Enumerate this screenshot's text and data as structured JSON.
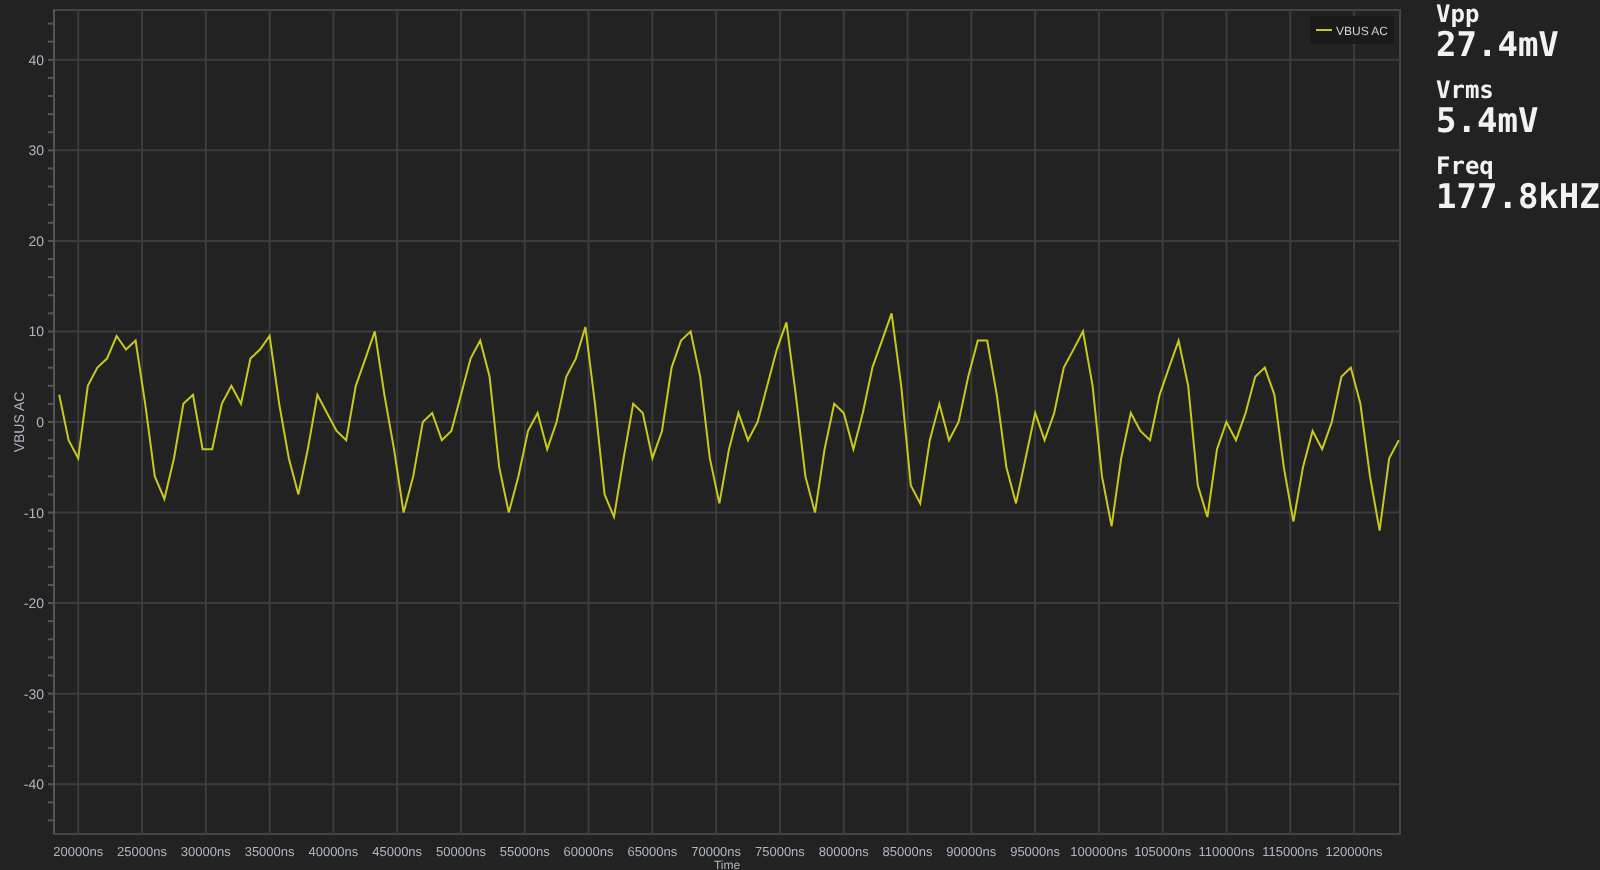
{
  "chart": {
    "chart_data": {
      "type": "line",
      "xlabel": "Time",
      "ylabel": "VBUS AC",
      "x": [
        18500,
        19250,
        20000,
        20750,
        21500,
        22250,
        23000,
        23750,
        24500,
        25250,
        26000,
        26750,
        27500,
        28250,
        29000,
        29750,
        30500,
        31250,
        32000,
        32750,
        33500,
        34250,
        35000,
        35750,
        36500,
        37250,
        38000,
        38750,
        39500,
        40250,
        41000,
        41750,
        42500,
        43250,
        44000,
        44750,
        45500,
        46250,
        47000,
        47750,
        48500,
        49250,
        50000,
        50750,
        51500,
        52250,
        53000,
        53750,
        54500,
        55250,
        56000,
        56750,
        57500,
        58250,
        59000,
        59750,
        60500,
        61250,
        62000,
        62750,
        63500,
        64250,
        65000,
        65750,
        66500,
        67250,
        68000,
        68750,
        69500,
        70250,
        71000,
        71750,
        72500,
        73250,
        74000,
        74750,
        75500,
        76250,
        77000,
        77750,
        78500,
        79250,
        80000,
        80750,
        81500,
        82250,
        83000,
        83750,
        84500,
        85250,
        86000,
        86750,
        87500,
        88250,
        89000,
        89750,
        90500,
        91250,
        92000,
        92750,
        93500,
        94250,
        95000,
        95750,
        96500,
        97250,
        98000,
        98750,
        99500,
        100250,
        101000,
        101750,
        102500,
        103250,
        104000,
        104750,
        105500,
        106250,
        107000,
        107750,
        108500,
        109250,
        110000,
        110750,
        111500,
        112250,
        113000,
        113750,
        114500,
        115250,
        116000,
        116750,
        117500,
        118250,
        119000,
        119750,
        120500,
        121250,
        122000,
        122750,
        123500
      ],
      "series": [
        {
          "name": "VBUS AC",
          "color": "#c8c81e",
          "values": [
            3,
            -2,
            -4,
            4,
            6,
            7,
            9.5,
            8,
            9,
            2,
            -6,
            -8.5,
            -4,
            2,
            3,
            -3,
            -3,
            2,
            4,
            2,
            7,
            8,
            9.5,
            2,
            -4,
            -8,
            -3,
            3,
            1,
            -1,
            -2,
            4,
            7,
            10,
            3,
            -3,
            -10,
            -6,
            0,
            1,
            -2,
            -1,
            3,
            7,
            9,
            5,
            -5,
            -10,
            -6,
            -1,
            1,
            -3,
            0,
            5,
            7,
            10.5,
            2,
            -8,
            -10.5,
            -4,
            2,
            1,
            -4,
            -1,
            6,
            9,
            10,
            5,
            -4,
            -9,
            -3,
            1,
            -2,
            0,
            4,
            8,
            11,
            3,
            -6,
            -10,
            -3,
            2,
            1,
            -3,
            1,
            6,
            9,
            12,
            4,
            -7,
            -9,
            -2,
            2,
            -2,
            0,
            5,
            9,
            9,
            3,
            -5,
            -9,
            -4,
            1,
            -2,
            1,
            6,
            8,
            10,
            4,
            -6,
            -11.5,
            -4,
            1,
            -1,
            -2,
            3,
            6,
            9,
            4,
            -7,
            -10.5,
            -3,
            0,
            -2,
            1,
            5,
            6,
            3,
            -5,
            -11,
            -5,
            -1,
            -3,
            0,
            5,
            6,
            2,
            -6,
            -12,
            -4,
            -2
          ]
        }
      ],
      "xlim": [
        18100,
        123600
      ],
      "ylim": [
        -45.5,
        45.5
      ],
      "xticks": [
        {
          "value": 20000,
          "label": "20000ns"
        },
        {
          "value": 25000,
          "label": "25000ns"
        },
        {
          "value": 30000,
          "label": "30000ns"
        },
        {
          "value": 35000,
          "label": "35000ns"
        },
        {
          "value": 40000,
          "label": "40000ns"
        },
        {
          "value": 45000,
          "label": "45000ns"
        },
        {
          "value": 50000,
          "label": "50000ns"
        },
        {
          "value": 55000,
          "label": "55000ns"
        },
        {
          "value": 60000,
          "label": "60000ns"
        },
        {
          "value": 65000,
          "label": "65000ns"
        },
        {
          "value": 70000,
          "label": "70000ns"
        },
        {
          "value": 75000,
          "label": "75000ns"
        },
        {
          "value": 80000,
          "label": "80000ns"
        },
        {
          "value": 85000,
          "label": "85000ns"
        },
        {
          "value": 90000,
          "label": "90000ns"
        },
        {
          "value": 95000,
          "label": "95000ns"
        },
        {
          "value": 100000,
          "label": "100000ns"
        },
        {
          "value": 105000,
          "label": "105000ns"
        },
        {
          "value": 110000,
          "label": "110000ns"
        },
        {
          "value": 115000,
          "label": "115000ns"
        },
        {
          "value": 120000,
          "label": "120000ns"
        }
      ],
      "yticks": [
        -40,
        -30,
        -20,
        -10,
        0,
        10,
        20,
        30,
        40
      ],
      "grid": true
    }
  },
  "readouts": [
    {
      "label": "Vpp",
      "value": "27.4mV"
    },
    {
      "label": "Vrms",
      "value": "5.4mV"
    },
    {
      "label": "Freq",
      "value": "177.8kHZ"
    }
  ]
}
